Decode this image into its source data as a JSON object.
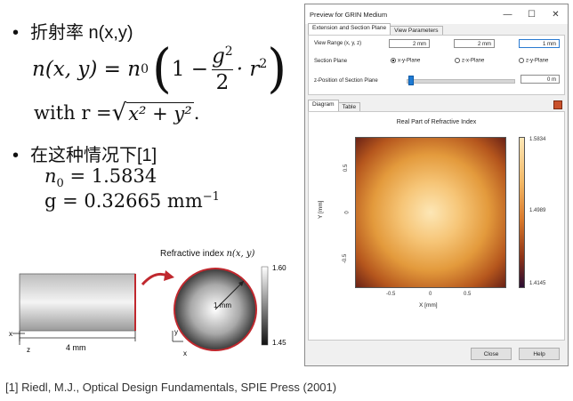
{
  "slide": {
    "bullet1_text": "折射率 n(x,y)",
    "equation": {
      "lhs": "n(x, y) = n",
      "lhs_sub": "0",
      "one_minus": "1 −",
      "frac_num": "g",
      "frac_num_sup": "2",
      "frac_den": "2",
      "times_r": "· r",
      "r_sup": "2"
    },
    "with_r": {
      "prefix": "with r = ",
      "radicand": "x² + y²",
      "suffix": "."
    },
    "bullet2_text": "在这种情况下[1]",
    "n0_lhs": "n",
    "n0_sub": "0",
    "n0_rhs": " = 1.5834",
    "g_line": "g = 0.32665 mm",
    "g_unit_sup": "−1",
    "figure": {
      "title_prefix": "Refractive index ",
      "title_func": "n(x, y)",
      "length_label": "4 mm",
      "radius_label": "1 mm",
      "axis_x": "x",
      "axis_y": "y",
      "axis_z": "z",
      "colorbar_max": "1.60",
      "colorbar_min": "1.45"
    },
    "reference": "[1] Riedl, M.J., Optical Design Fundamentals, SPIE Press (2001)"
  },
  "window": {
    "title": "Preview for GRIN Medium",
    "minimize": "—",
    "maximize": "☐",
    "close": "✕",
    "tabs": [
      "Extension and Section Plane",
      "View Parameters"
    ],
    "view_range_label": "View Range (x, y, z)",
    "view_range_values": [
      "2 mm",
      "2 mm",
      "1 mm"
    ],
    "section_plane_label": "Section Plane",
    "section_plane_options": [
      "x-y-Plane",
      "z-x-Plane",
      "z-y-Plane"
    ],
    "section_plane_selected": "x-y-Plane",
    "z_position_label": "z-Position of Section Plane",
    "z_position_value": "0 m",
    "bottom_tabs": [
      "Diagram",
      "Table"
    ],
    "diagram_title": "Real Part of Refractive Index",
    "x_axis_label": "X [mm]",
    "y_axis_label": "Y [mm]",
    "x_ticks": [
      "-0.5",
      "0",
      "0.5"
    ],
    "y_ticks": [
      "0.5",
      "0",
      "-0.5"
    ],
    "colorbar_ticks": [
      "1.5834",
      "1.4989",
      "1.4145"
    ],
    "close_button": "Close",
    "help_button": "Help"
  },
  "colors": {
    "accent_blue": "#1e7ad3",
    "red_arrow": "#c0282e",
    "heat_max": "#fde7b6",
    "heat_mid": "#e39a3c",
    "heat_min": "#2a0d33"
  }
}
